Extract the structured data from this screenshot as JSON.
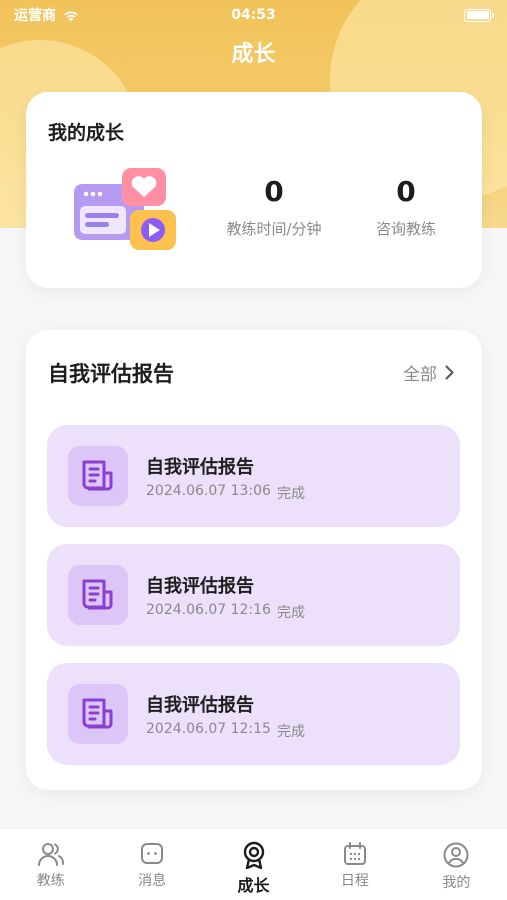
{
  "status_bar": {
    "carrier": "运营商",
    "time": "04:53"
  },
  "header": {
    "title": "成长"
  },
  "growth": {
    "title": "我的成长",
    "stats": [
      {
        "value": "0",
        "label": "教练时间/分钟"
      },
      {
        "value": "0",
        "label": "咨询教练"
      }
    ]
  },
  "reports": {
    "title": "自我评估报告",
    "view_all": "全部",
    "items": [
      {
        "name": "自我评估报告",
        "datetime": "2024.06.07 13:06",
        "status": "完成"
      },
      {
        "name": "自我评估报告",
        "datetime": "2024.06.07 12:16",
        "status": "完成"
      },
      {
        "name": "自我评估报告",
        "datetime": "2024.06.07 12:15",
        "status": "完成"
      }
    ]
  },
  "tabbar": {
    "items": [
      {
        "label": "教练",
        "icon": "people-icon"
      },
      {
        "label": "消息",
        "icon": "chat-icon"
      },
      {
        "label": "成长",
        "icon": "medal-icon",
        "active": true
      },
      {
        "label": "日程",
        "icon": "calendar-icon"
      },
      {
        "label": "我的",
        "icon": "profile-icon"
      }
    ]
  },
  "colors": {
    "hero": "#f2c25a",
    "report_item_bg": "#ece0fb",
    "report_icon_bg": "#dcc6f7",
    "report_icon_stroke": "#8a3fd1"
  }
}
